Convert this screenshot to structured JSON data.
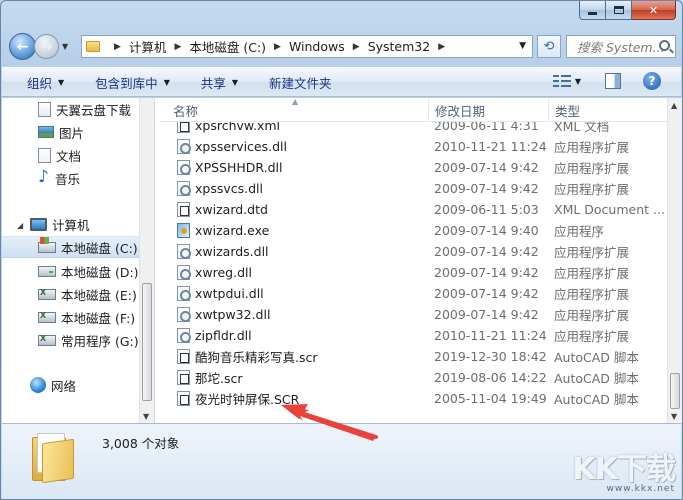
{
  "window": {
    "path_root_icon": "folder-icon"
  },
  "address": {
    "crumbs": [
      "计算机",
      "本地磁盘 (C:)",
      "Windows",
      "System32"
    ]
  },
  "search": {
    "placeholder": "搜索 System..."
  },
  "toolbar": {
    "organize": "组织",
    "include_in_library": "包含到库中",
    "share": "共享",
    "new_folder": "新建文件夹"
  },
  "navpane": {
    "favorites": [
      {
        "label": "天翼云盘下载",
        "icon": "cloud-doc-icon"
      },
      {
        "label": "图片",
        "icon": "pictures-icon"
      },
      {
        "label": "文档",
        "icon": "documents-icon"
      },
      {
        "label": "音乐",
        "icon": "music-icon"
      }
    ],
    "computer": "计算机",
    "drives": [
      {
        "label": "本地磁盘 (C:)",
        "icon": "drive-c-icon",
        "selected": true
      },
      {
        "label": "本地磁盘 (D:)",
        "icon": "drive-icon"
      },
      {
        "label": "本地磁盘 (E:)",
        "icon": "drive-icon"
      },
      {
        "label": "本地磁盘 (F:)",
        "icon": "drive-icon"
      },
      {
        "label": "常用程序 (G:)",
        "icon": "drive-icon"
      }
    ],
    "network": "网络"
  },
  "columns": {
    "name": "名称",
    "date": "修改日期",
    "type": "类型"
  },
  "files": [
    {
      "name": "xpsrchvw.xml",
      "date": "2009-06-11 4:31",
      "type": "XML 文档",
      "kind": "dtd"
    },
    {
      "name": "xpsservices.dll",
      "date": "2010-11-21 11:24",
      "type": "应用程序扩展",
      "kind": "dll"
    },
    {
      "name": "XPSSHHDR.dll",
      "date": "2009-07-14 9:42",
      "type": "应用程序扩展",
      "kind": "dll"
    },
    {
      "name": "xpssvcs.dll",
      "date": "2009-07-14 9:42",
      "type": "应用程序扩展",
      "kind": "dll"
    },
    {
      "name": "xwizard.dtd",
      "date": "2009-06-11 5:03",
      "type": "XML Document ...",
      "kind": "dtd"
    },
    {
      "name": "xwizard.exe",
      "date": "2009-07-14 9:40",
      "type": "应用程序",
      "kind": "exe"
    },
    {
      "name": "xwizards.dll",
      "date": "2009-07-14 9:42",
      "type": "应用程序扩展",
      "kind": "dll"
    },
    {
      "name": "xwreg.dll",
      "date": "2009-07-14 9:42",
      "type": "应用程序扩展",
      "kind": "dll"
    },
    {
      "name": "xwtpdui.dll",
      "date": "2009-07-14 9:42",
      "type": "应用程序扩展",
      "kind": "dll"
    },
    {
      "name": "xwtpw32.dll",
      "date": "2009-07-14 9:42",
      "type": "应用程序扩展",
      "kind": "dll"
    },
    {
      "name": "zipfldr.dll",
      "date": "2010-11-21 11:24",
      "type": "应用程序扩展",
      "kind": "dll"
    },
    {
      "name": "酷狗音乐精彩写真.scr",
      "date": "2019-12-30 18:42",
      "type": "AutoCAD 脚本",
      "kind": "scr"
    },
    {
      "name": "那坨.scr",
      "date": "2019-08-06 14:22",
      "type": "AutoCAD 脚本",
      "kind": "scr"
    },
    {
      "name": "夜光时钟屏保.SCR",
      "date": "2005-11-04 19:49",
      "type": "AutoCAD 脚本",
      "kind": "scr"
    }
  ],
  "details": {
    "count": "3,008 个对象"
  },
  "watermark": {
    "main": "KK下载",
    "url": "www.kkx.net"
  },
  "colors": {
    "annotation_arrow": "#e8433a"
  }
}
